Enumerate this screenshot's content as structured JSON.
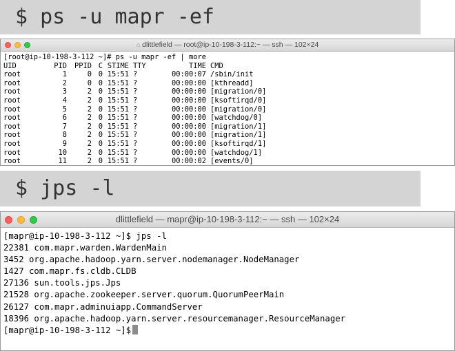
{
  "banners": {
    "ps": "$ ps -u mapr -ef",
    "jps": "$ jps -l"
  },
  "window1": {
    "title": "dlittlefield — root@ip-10-198-3-112:~ — ssh — 102×24",
    "prompt": "[root@ip-10-198-3-112 ~]# ps -u mapr -ef | more",
    "header": [
      "UID",
      "PID",
      "PPID",
      "C",
      "STIME",
      "TTY",
      "TIME",
      "CMD"
    ],
    "rows": [
      [
        "root",
        "1",
        "0",
        "0",
        "15:51",
        "?",
        "00:00:07",
        "/sbin/init"
      ],
      [
        "root",
        "2",
        "0",
        "0",
        "15:51",
        "?",
        "00:00:00",
        "[kthreadd]"
      ],
      [
        "root",
        "3",
        "2",
        "0",
        "15:51",
        "?",
        "00:00:00",
        "[migration/0]"
      ],
      [
        "root",
        "4",
        "2",
        "0",
        "15:51",
        "?",
        "00:00:00",
        "[ksoftirqd/0]"
      ],
      [
        "root",
        "5",
        "2",
        "0",
        "15:51",
        "?",
        "00:00:00",
        "[migration/0]"
      ],
      [
        "root",
        "6",
        "2",
        "0",
        "15:51",
        "?",
        "00:00:00",
        "[watchdog/0]"
      ],
      [
        "root",
        "7",
        "2",
        "0",
        "15:51",
        "?",
        "00:00:00",
        "[migration/1]"
      ],
      [
        "root",
        "8",
        "2",
        "0",
        "15:51",
        "?",
        "00:00:00",
        "[migration/1]"
      ],
      [
        "root",
        "9",
        "2",
        "0",
        "15:51",
        "?",
        "00:00:00",
        "[ksoftirqd/1]"
      ],
      [
        "root",
        "10",
        "2",
        "0",
        "15:51",
        "?",
        "00:00:00",
        "[watchdog/1]"
      ],
      [
        "root",
        "11",
        "2",
        "0",
        "15:51",
        "?",
        "00:00:02",
        "[events/0]"
      ]
    ]
  },
  "window2": {
    "title": "dlittlefield — mapr@ip-10-198-3-112:~ — ssh — 102×24",
    "prompt": "[mapr@ip-10-198-3-112 ~]$ jps -l",
    "lines": [
      "22381 com.mapr.warden.WardenMain",
      "3452 org.apache.hadoop.yarn.server.nodemanager.NodeManager",
      "1427 com.mapr.fs.cldb.CLDB",
      "27136 sun.tools.jps.Jps",
      "21528 org.apache.zookeeper.server.quorum.QuorumPeerMain",
      "26127 com.mapr.adminuiapp.CommandServer",
      "18396 org.apache.hadoop.yarn.server.resourcemanager.ResourceManager"
    ],
    "final_prompt": "[mapr@ip-10-198-3-112 ~]$"
  },
  "icons": {
    "close": "close-icon",
    "minimize": "minimize-icon",
    "zoom": "zoom-icon",
    "home": "home-icon"
  },
  "colors": {
    "close": "#fc605c",
    "minimize": "#fdbc40",
    "zoom": "#34c84a",
    "banner": "#d4d4d4"
  }
}
